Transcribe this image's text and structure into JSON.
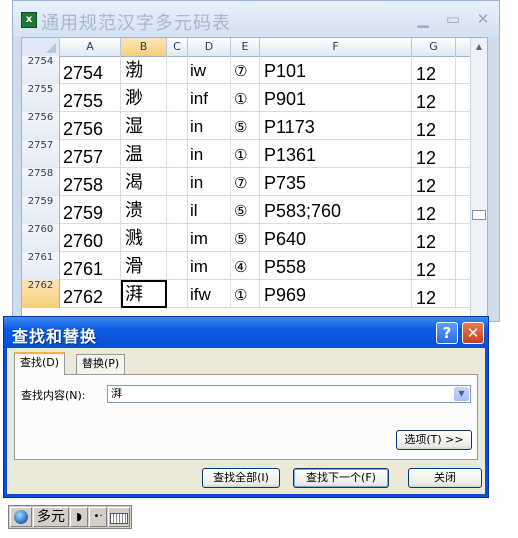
{
  "spreadsheet": {
    "title": "通用规范汉字多元码表",
    "columns": [
      "A",
      "B",
      "C",
      "D",
      "E",
      "F",
      "G"
    ],
    "rows": [
      {
        "num": "2754",
        "a": "2754",
        "b": "渤",
        "c": "",
        "d": "iw",
        "e": "⑦",
        "f": "P101",
        "g": "12"
      },
      {
        "num": "2755",
        "a": "2755",
        "b": "渺",
        "c": "",
        "d": "inf",
        "e": "①",
        "f": "P901",
        "g": "12"
      },
      {
        "num": "2756",
        "a": "2756",
        "b": "湿",
        "c": "",
        "d": "in",
        "e": "⑤",
        "f": "P1173",
        "g": "12"
      },
      {
        "num": "2757",
        "a": "2757",
        "b": "温",
        "c": "",
        "d": "in",
        "e": "①",
        "f": "P1361",
        "g": "12"
      },
      {
        "num": "2758",
        "a": "2758",
        "b": "渴",
        "c": "",
        "d": "in",
        "e": "⑦",
        "f": "P735",
        "g": "12"
      },
      {
        "num": "2759",
        "a": "2759",
        "b": "溃",
        "c": "",
        "d": "il",
        "e": "⑤",
        "f": "P583;760",
        "g": "12"
      },
      {
        "num": "2760",
        "a": "2760",
        "b": "溅",
        "c": "",
        "d": "im",
        "e": "⑤",
        "f": "P640",
        "g": "12"
      },
      {
        "num": "2761",
        "a": "2761",
        "b": "滑",
        "c": "",
        "d": "im",
        "e": "④",
        "f": "P558",
        "g": "12"
      },
      {
        "num": "2762",
        "a": "2762",
        "b": "湃",
        "c": "",
        "d": "ifw",
        "e": "①",
        "f": "P969",
        "g": "12"
      }
    ]
  },
  "dialog": {
    "title": "查找和替换",
    "help": "?",
    "close": "✕",
    "tabs": {
      "find": "查找(D)",
      "replace": "替换(P)"
    },
    "find_label": "查找内容(N):",
    "find_value": "湃",
    "options_button": "选项(T) >>",
    "find_all_button": "查找全部(I)",
    "find_next_button": "查找下一个(F)",
    "close_button": "关闭"
  },
  "ime": {
    "name": "多元"
  }
}
